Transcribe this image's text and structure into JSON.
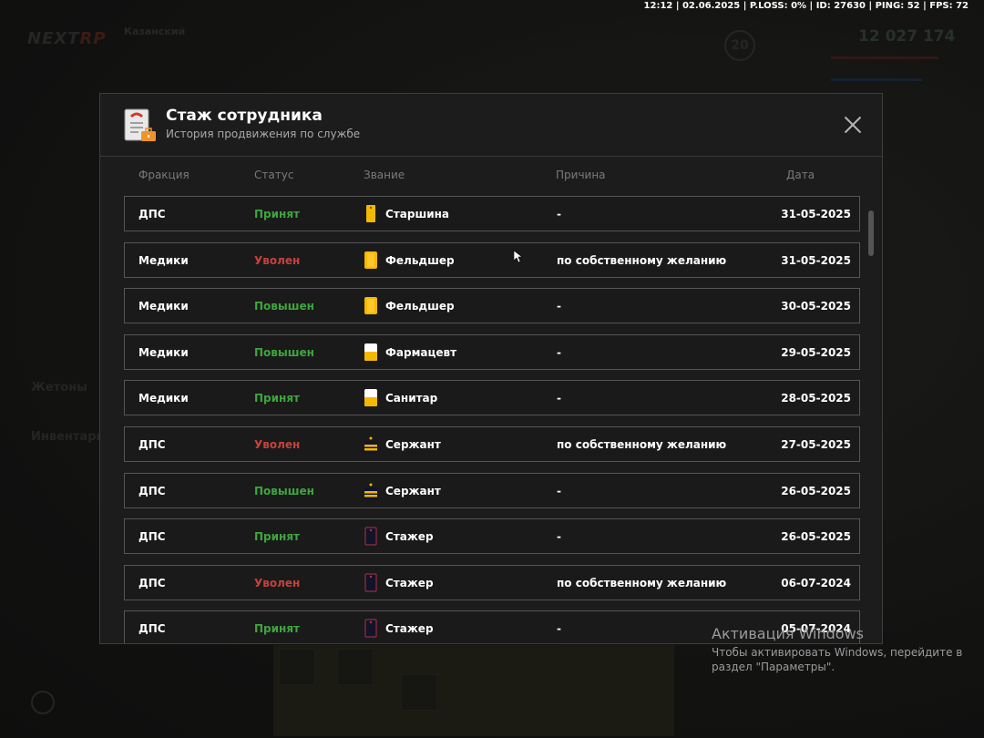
{
  "status_bar": "12:12 | 02.06.2025 | P.LOSS: 0% | ID: 27630 | PING: 52 | FPS: 72",
  "background": {
    "logo": "NEXT",
    "logo_accent": "RP",
    "server_name": "Казанский",
    "money": "12 027 174",
    "level": "20",
    "tokens_label": "Жетоны",
    "inventory_label": "Инвентарь"
  },
  "modal": {
    "title": "Стаж сотрудника",
    "subtitle": "История продвижения по службе",
    "columns": {
      "faction": "Фракция",
      "status": "Статус",
      "rank": "Звание",
      "reason": "Причина",
      "date": "Дата"
    },
    "rows": [
      {
        "faction": "ДПС",
        "status": "Принят",
        "status_type": "green",
        "rank": "Старшина",
        "rank_icon": "shoulder-strap-yellow-icon",
        "reason": "-",
        "date": "31-05-2025"
      },
      {
        "faction": "Медики",
        "status": "Уволен",
        "status_type": "red",
        "rank": "Фельдшер",
        "rank_icon": "badge-yellow-icon",
        "reason": "по собственному желанию",
        "date": "31-05-2025"
      },
      {
        "faction": "Медики",
        "status": "Повышен",
        "status_type": "green",
        "rank": "Фельдшер",
        "rank_icon": "badge-yellow-icon",
        "reason": "-",
        "date": "30-05-2025"
      },
      {
        "faction": "Медики",
        "status": "Повышен",
        "status_type": "green",
        "rank": "Фармацевт",
        "rank_icon": "badge-white-yellow-icon",
        "reason": "-",
        "date": "29-05-2025"
      },
      {
        "faction": "Медики",
        "status": "Принят",
        "status_type": "green",
        "rank": "Санитар",
        "rank_icon": "badge-white-yellow-icon",
        "reason": "-",
        "date": "28-05-2025"
      },
      {
        "faction": "ДПС",
        "status": "Уволен",
        "status_type": "red",
        "rank": "Сержант",
        "rank_icon": "sergeant-stripes-icon",
        "reason": "по собственному желанию",
        "date": "27-05-2025"
      },
      {
        "faction": "ДПС",
        "status": "Повышен",
        "status_type": "green",
        "rank": "Сержант",
        "rank_icon": "sergeant-stripes-icon",
        "reason": "-",
        "date": "26-05-2025"
      },
      {
        "faction": "ДПС",
        "status": "Принят",
        "status_type": "green",
        "rank": "Стажер",
        "rank_icon": "shoulder-strap-dark-icon",
        "reason": "-",
        "date": "26-05-2025"
      },
      {
        "faction": "ДПС",
        "status": "Уволен",
        "status_type": "red",
        "rank": "Стажер",
        "rank_icon": "shoulder-strap-dark-icon",
        "reason": "по собственному желанию",
        "date": "06-07-2024"
      },
      {
        "faction": "ДПС",
        "status": "Принят",
        "status_type": "green",
        "rank": "Стажер",
        "rank_icon": "shoulder-strap-dark-icon",
        "reason": "-",
        "date": "05-07-2024"
      }
    ]
  },
  "watermark": {
    "title": "Активация Windows",
    "text": "Чтобы активировать Windows, перейдите в раздел \"Параметры\"."
  },
  "colors": {
    "status_green": "#3ea53e",
    "status_red": "#c4423c",
    "rank_yellow": "#f5b800"
  }
}
